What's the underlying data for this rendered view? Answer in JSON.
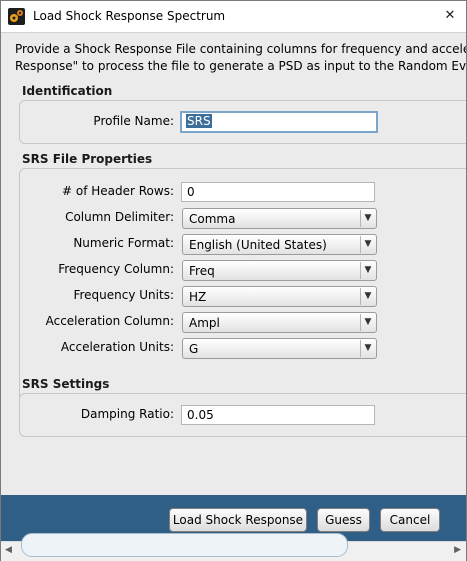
{
  "window": {
    "title": "Load Shock Response Spectrum",
    "close_symbol": "✕"
  },
  "intro": {
    "line1": "Provide a Shock Response File containing columns for frequency and acceleration. Cl",
    "line2": "Response\" to process the file to generate a PSD as input to the Random Event Profile."
  },
  "identification": {
    "title": "Identification",
    "profile_name_label": "Profile Name:",
    "profile_name_value": "SRS"
  },
  "file_properties": {
    "title": "SRS File Properties",
    "header_rows_label": "# of Header Rows:",
    "header_rows_value": "0",
    "delimiter_label": "Column Delimiter:",
    "delimiter_value": "Comma",
    "numeric_format_label": "Numeric Format:",
    "numeric_format_value": "English (United States)",
    "frequency_column_label": "Frequency Column:",
    "frequency_column_value": "Freq",
    "frequency_units_label": "Frequency Units:",
    "frequency_units_value": "HZ",
    "acceleration_column_label": "Acceleration Column:",
    "acceleration_column_value": "Ampl",
    "acceleration_units_label": "Acceleration Units:",
    "acceleration_units_value": "G"
  },
  "settings": {
    "title": "SRS Settings",
    "damping_label": "Damping Ratio:",
    "damping_value": "0.05"
  },
  "buttons": {
    "load": "Load Shock Response",
    "guess": "Guess",
    "cancel": "Cancel"
  },
  "colors": {
    "footer": "#2f5f86",
    "selection": "#3c6e9b",
    "focus_border": "#7aa6cc"
  }
}
